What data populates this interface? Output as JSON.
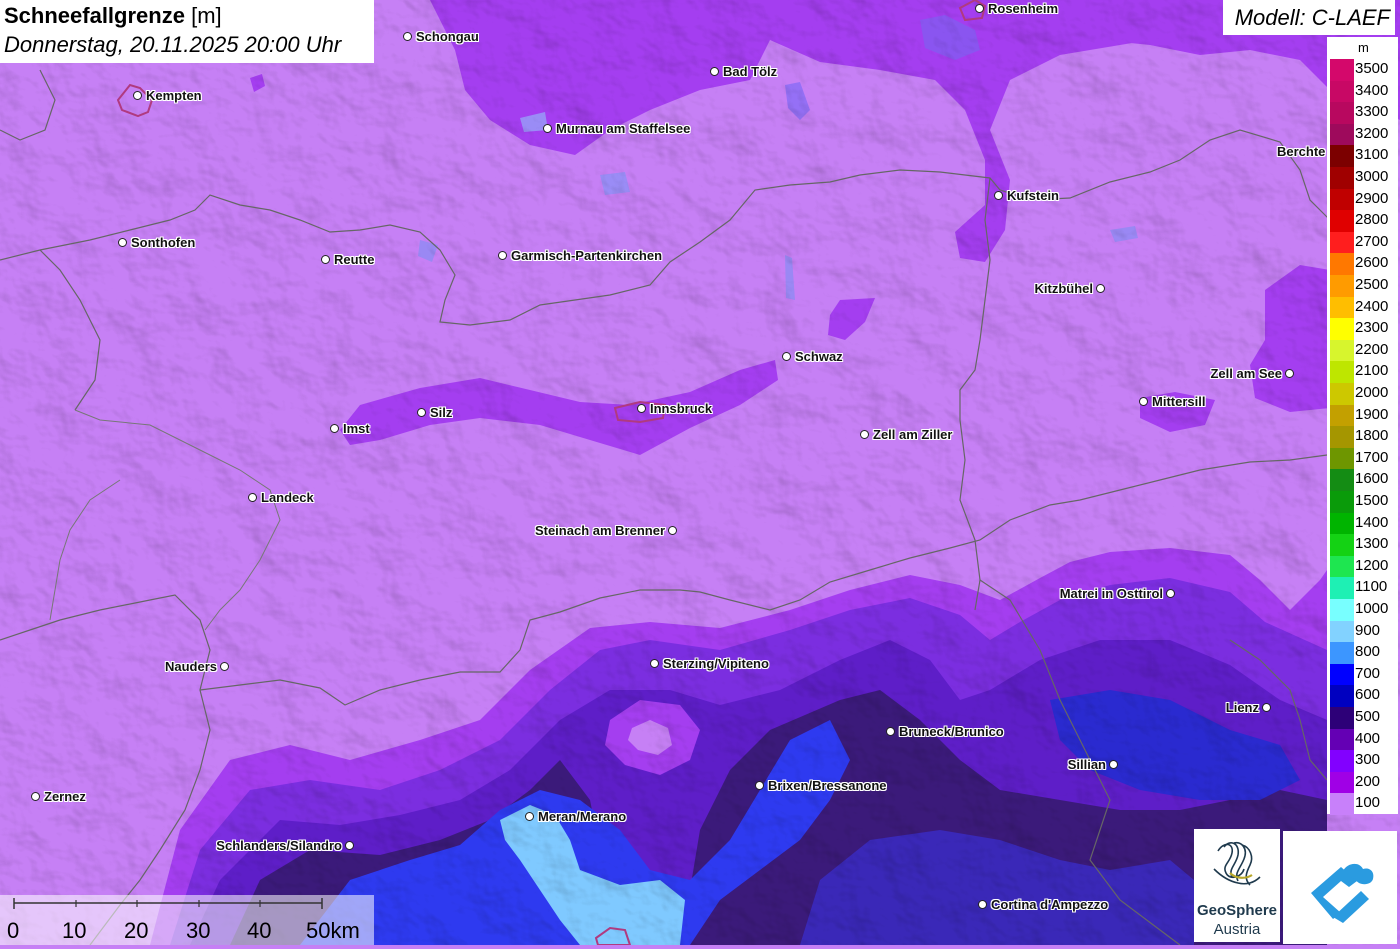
{
  "title": {
    "parameter": "Schneefallgrenze",
    "unit": "[m]",
    "datetime": "Donnerstag, 20.11.2025 20:00 Uhr"
  },
  "model": "Modell: C-LAEF",
  "legend": {
    "unit": "m",
    "levels": [
      {
        "value": "3500",
        "color": "#d4086b"
      },
      {
        "value": "3400",
        "color": "#c80865"
      },
      {
        "value": "3300",
        "color": "#b8085f"
      },
      {
        "value": "3200",
        "color": "#9e0a5c"
      },
      {
        "value": "3100",
        "color": "#7c0000"
      },
      {
        "value": "3000",
        "color": "#a00000"
      },
      {
        "value": "2900",
        "color": "#c00000"
      },
      {
        "value": "2800",
        "color": "#e00000"
      },
      {
        "value": "2700",
        "color": "#ff1e1e"
      },
      {
        "value": "2600",
        "color": "#ff7800"
      },
      {
        "value": "2500",
        "color": "#ff9b00"
      },
      {
        "value": "2400",
        "color": "#ffbe00"
      },
      {
        "value": "2300",
        "color": "#ffff00"
      },
      {
        "value": "2200",
        "color": "#d7f52d"
      },
      {
        "value": "2100",
        "color": "#bee600"
      },
      {
        "value": "2000",
        "color": "#cdc800"
      },
      {
        "value": "1900",
        "color": "#c3a000"
      },
      {
        "value": "1800",
        "color": "#a59600"
      },
      {
        "value": "1700",
        "color": "#6e9600"
      },
      {
        "value": "1600",
        "color": "#148c14"
      },
      {
        "value": "1500",
        "color": "#0a9b0a"
      },
      {
        "value": "1400",
        "color": "#00b400"
      },
      {
        "value": "1300",
        "color": "#14d214"
      },
      {
        "value": "1200",
        "color": "#1ee650"
      },
      {
        "value": "1100",
        "color": "#1ef0b4"
      },
      {
        "value": "1000",
        "color": "#78ffff"
      },
      {
        "value": "900",
        "color": "#82d2ff"
      },
      {
        "value": "800",
        "color": "#3c96ff"
      },
      {
        "value": "700",
        "color": "#0000ff"
      },
      {
        "value": "600",
        "color": "#0000c0"
      },
      {
        "value": "500",
        "color": "#2d0078"
      },
      {
        "value": "400",
        "color": "#6400b4"
      },
      {
        "value": "300",
        "color": "#8200ff"
      },
      {
        "value": "200",
        "color": "#a000e6"
      },
      {
        "value": "100",
        "color": "#c880fa"
      }
    ]
  },
  "cities": [
    {
      "name": "Rosenheim",
      "dot": "left"
    },
    {
      "name": "Schongau",
      "dot": "left"
    },
    {
      "name": "Kempten",
      "dot": "left"
    },
    {
      "name": "Bad Tölz",
      "dot": "left"
    },
    {
      "name": "Murnau am Staffelsee",
      "dot": "left"
    },
    {
      "name": "Berchte",
      "dot": "none"
    },
    {
      "name": "Kufstein",
      "dot": "left"
    },
    {
      "name": "Sonthofen",
      "dot": "left"
    },
    {
      "name": "Reutte",
      "dot": "left"
    },
    {
      "name": "Garmisch-Partenkirchen",
      "dot": "left"
    },
    {
      "name": "Kitzbühel",
      "dot": "right"
    },
    {
      "name": "Schwaz",
      "dot": "left"
    },
    {
      "name": "Zell am See",
      "dot": "right"
    },
    {
      "name": "Mittersill",
      "dot": "left"
    },
    {
      "name": "Silz",
      "dot": "left"
    },
    {
      "name": "Imst",
      "dot": "left"
    },
    {
      "name": "Innsbruck",
      "dot": "left"
    },
    {
      "name": "Zell am Ziller",
      "dot": "left"
    },
    {
      "name": "Landeck",
      "dot": "left"
    },
    {
      "name": "Steinach am Brenner",
      "dot": "right"
    },
    {
      "name": "Matrei in Osttirol",
      "dot": "right"
    },
    {
      "name": "Nauders",
      "dot": "right"
    },
    {
      "name": "Sterzing/Vipiteno",
      "dot": "left"
    },
    {
      "name": "Lienz",
      "dot": "right"
    },
    {
      "name": "Bruneck/Brunico",
      "dot": "left"
    },
    {
      "name": "Sillian",
      "dot": "right"
    },
    {
      "name": "Brixen/Bressanone",
      "dot": "left"
    },
    {
      "name": "Zernez",
      "dot": "left"
    },
    {
      "name": "Meran/Merano",
      "dot": "left"
    },
    {
      "name": "Schlanders/Silandro",
      "dot": "right"
    },
    {
      "name": "Cortina d'Ampezzo",
      "dot": "left"
    }
  ],
  "scalebar": {
    "labels": [
      "0",
      "10",
      "20",
      "30",
      "40",
      "50km"
    ]
  },
  "logos": {
    "geosphere_line1": "GeoSphere",
    "geosphere_line2": "Austria"
  },
  "colors": {
    "base_snowline": "#c680f5",
    "low_200": "#a43ef0",
    "low_300": "#7b2ee0",
    "low_400": "#5e1ec8",
    "low_500": "#3b1a7a",
    "low_600": "#2a20c8",
    "low_700": "#2e3af0",
    "low_900": "#7fc9ff"
  }
}
